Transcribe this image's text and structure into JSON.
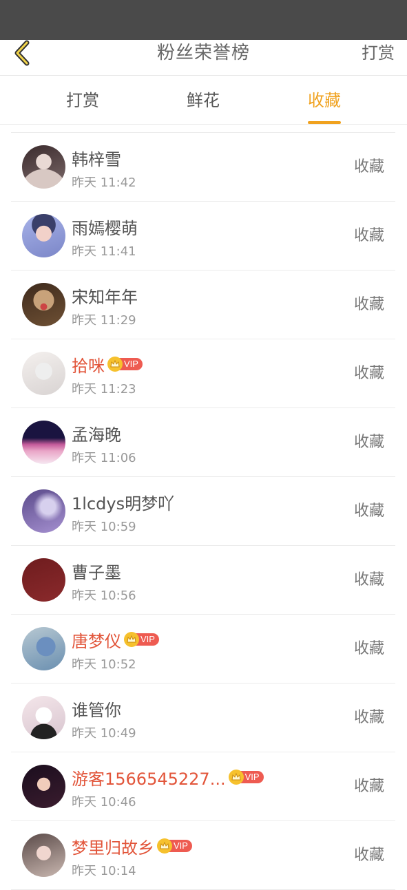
{
  "nav": {
    "title": "粉丝荣誉榜",
    "action": "打赏"
  },
  "tabs": [
    {
      "label": "打赏",
      "active": false
    },
    {
      "label": "鲜花",
      "active": false
    },
    {
      "label": "收藏",
      "active": true
    }
  ],
  "accent_color": "#f0a21f",
  "vip_name_color": "#e2553a",
  "list": [
    {
      "name": "韩梓雪",
      "time": "昨天 11:42",
      "vip": false,
      "action": "收藏"
    },
    {
      "name": "雨嫣樱萌",
      "time": "昨天 11:41",
      "vip": false,
      "action": "收藏"
    },
    {
      "name": "宋知年年",
      "time": "昨天 11:29",
      "vip": false,
      "action": "收藏"
    },
    {
      "name": "拾咪",
      "time": "昨天 11:23",
      "vip": true,
      "vip_label": "VIP",
      "action": "收藏"
    },
    {
      "name": "孟海晚",
      "time": "昨天 11:06",
      "vip": false,
      "action": "收藏"
    },
    {
      "name": "1lcdys明梦吖",
      "time": "昨天 10:59",
      "vip": false,
      "action": "收藏"
    },
    {
      "name": "曹子墨",
      "time": "昨天 10:56",
      "vip": false,
      "action": "收藏"
    },
    {
      "name": "唐梦仪",
      "time": "昨天 10:52",
      "vip": true,
      "vip_label": "VIP",
      "action": "收藏"
    },
    {
      "name": "谁管你",
      "time": "昨天 10:49",
      "vip": false,
      "action": "收藏"
    },
    {
      "name": "游客1566545227...",
      "time": "昨天 10:46",
      "vip": true,
      "vip_label": "VIP",
      "action": "收藏"
    },
    {
      "name": "梦里归故乡",
      "time": "昨天 10:14",
      "vip": true,
      "vip_label": "VIP",
      "action": "收藏"
    }
  ]
}
